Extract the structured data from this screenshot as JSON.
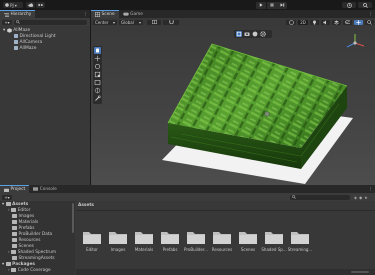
{
  "toolbar": {
    "account_label": "PJ",
    "cloud_icon": "cloud-icon"
  },
  "hierarchy": {
    "tab_label": "Hierarchy",
    "items": [
      {
        "label": "AllMaze",
        "level": 0
      },
      {
        "label": "Directional Light",
        "level": 1
      },
      {
        "label": "AllCamera",
        "level": 1
      },
      {
        "label": "AllMaze",
        "level": 1
      }
    ]
  },
  "project_tab": {
    "label": "Project"
  },
  "console_tab": {
    "label": "Console"
  },
  "scene": {
    "scene_tab": "Scene",
    "game_tab": "Game",
    "shading_mode": "Center",
    "pivot_mode": "Global",
    "mode_2d": "2D"
  },
  "project": {
    "tree": [
      {
        "label": "Assets",
        "level": 0,
        "bold": true
      },
      {
        "label": "Editor",
        "level": 1
      },
      {
        "label": "Images",
        "level": 1
      },
      {
        "label": "Materials",
        "level": 1
      },
      {
        "label": "Prefabs",
        "level": 1
      },
      {
        "label": "ProBuilder Data",
        "level": 1
      },
      {
        "label": "Resources",
        "level": 1
      },
      {
        "label": "Scenes",
        "level": 1
      },
      {
        "label": "Shaded Spectrum",
        "level": 1
      },
      {
        "label": "StreamingAssets",
        "level": 1
      },
      {
        "label": "Packages",
        "level": 0,
        "bold": true
      },
      {
        "label": "Code Coverage",
        "level": 1
      }
    ],
    "breadcrumb": "Assets",
    "folders": [
      "Editor",
      "Images",
      "Materials",
      "Prefabs",
      "ProBuilder...",
      "Resources",
      "Scenes",
      "Shaded Sp...",
      "Streaming..."
    ]
  }
}
